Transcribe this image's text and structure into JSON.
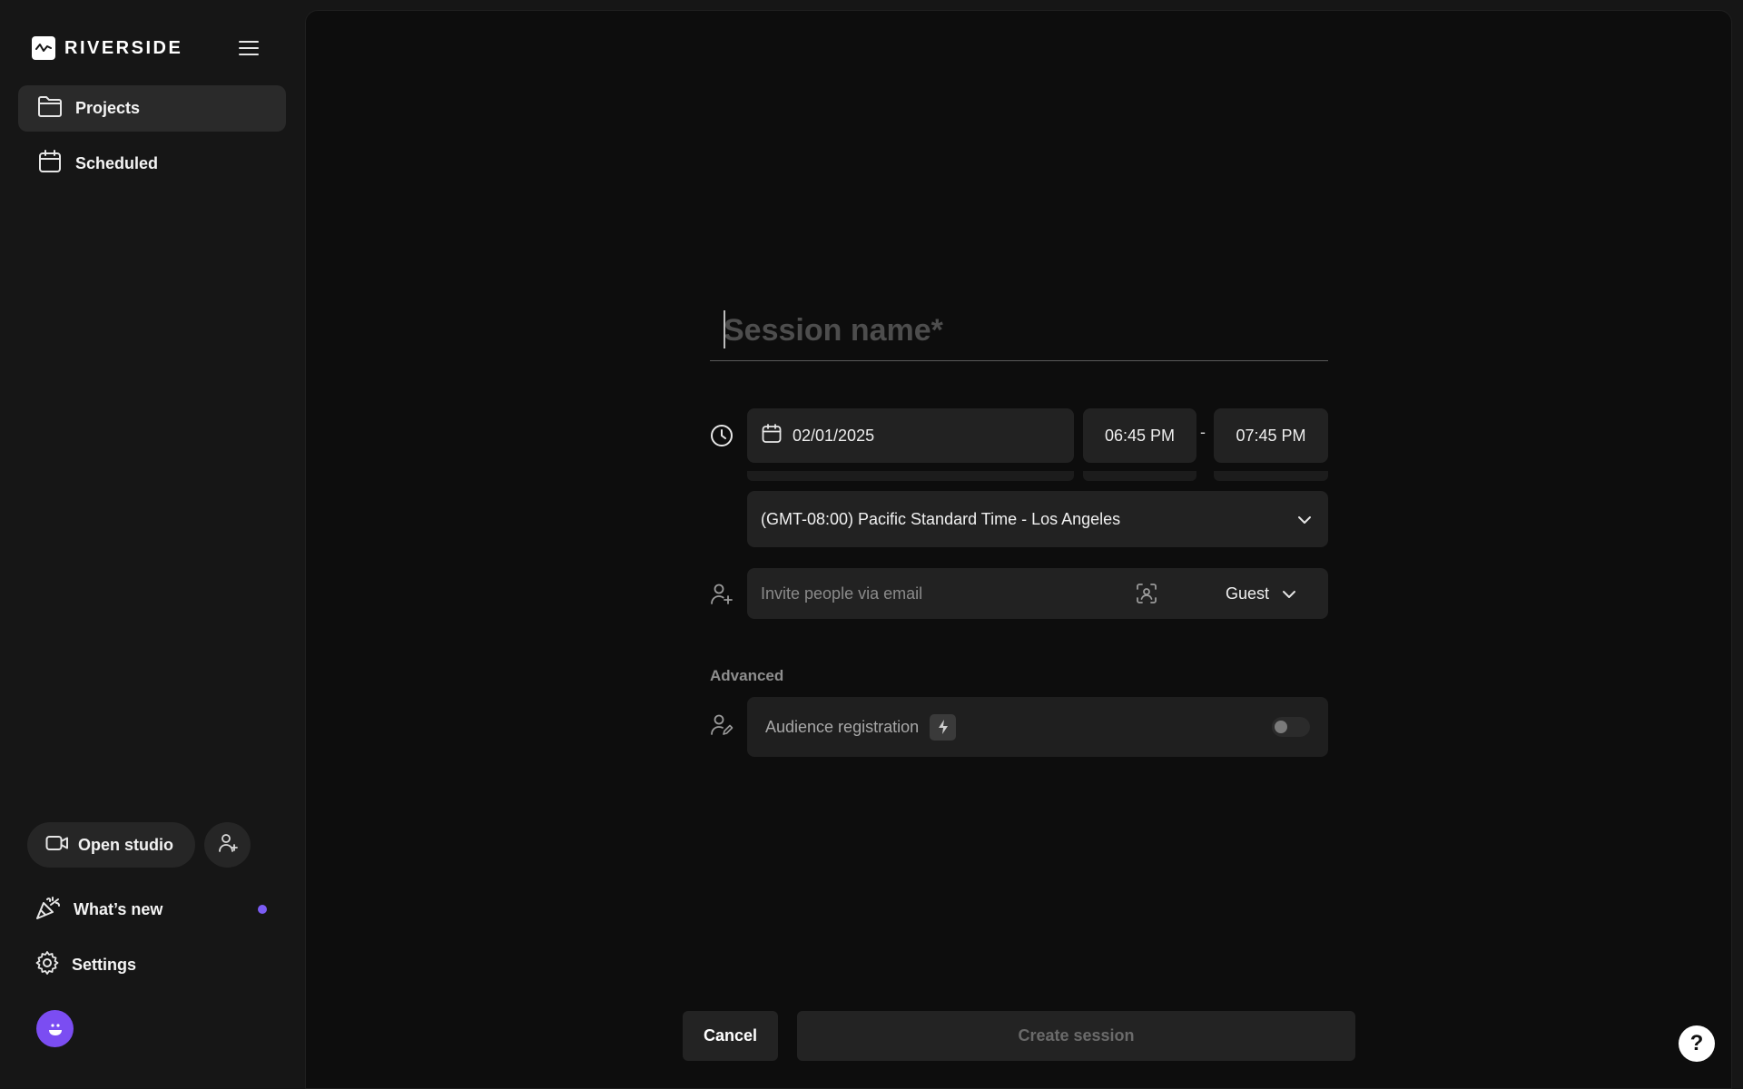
{
  "app": {
    "brand": "RIVERSIDE"
  },
  "sidebar": {
    "items": [
      {
        "label": "Projects",
        "icon": "folder-icon",
        "active": true
      },
      {
        "label": "Scheduled",
        "icon": "calendar-icon",
        "active": false
      }
    ],
    "open_studio_label": "Open studio",
    "whats_new_label": "What’s new",
    "settings_label": "Settings",
    "notification_dot_color": "#7b5cf5",
    "avatar_color": "#7b4df2"
  },
  "form": {
    "session_name": {
      "value": "",
      "placeholder": "Session name*"
    },
    "date": "02/01/2025",
    "start_time": "06:45 PM",
    "separator": "-",
    "end_time": "07:45 PM",
    "timezone": "(GMT-08:00) Pacific Standard Time - Los Angeles",
    "invite": {
      "value": "",
      "placeholder": "Invite people via email",
      "role": "Guest"
    },
    "advanced_label": "Advanced",
    "audience_registration": {
      "label": "Audience registration",
      "enabled": false
    }
  },
  "actions": {
    "cancel_label": "Cancel",
    "create_label": "Create session"
  },
  "help": {
    "label": "?"
  },
  "colors": {
    "accent": "#7b5cf5",
    "background": "#0d0d0d",
    "sidebar": "#161616",
    "field": "#222222"
  }
}
